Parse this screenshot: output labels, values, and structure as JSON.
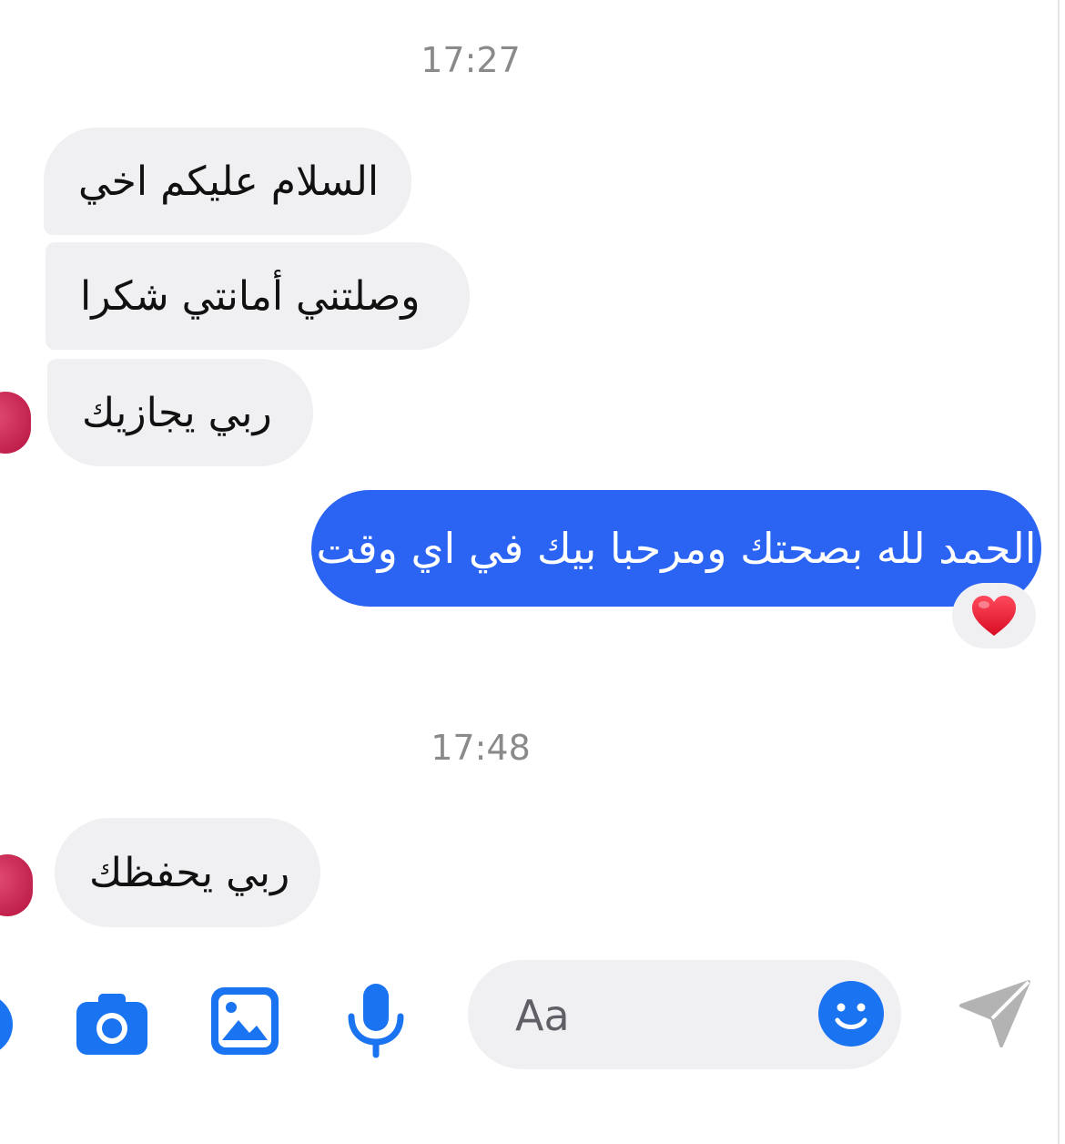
{
  "conversation": {
    "timestamps": [
      "17:27",
      "17:48"
    ],
    "messages": [
      {
        "direction": "incoming",
        "text": "السلام عليكم اخي"
      },
      {
        "direction": "incoming",
        "text": "وصلتني أمانتي شكرا"
      },
      {
        "direction": "incoming",
        "text": "ربي يجازيك"
      },
      {
        "direction": "outgoing",
        "text": "الحمد لله بصحتك ومرحبا بيك في اي وقت",
        "reaction": "heart"
      },
      {
        "direction": "incoming",
        "text": "ربي يحفظك"
      }
    ]
  },
  "composer": {
    "placeholder": "Aa",
    "icons": [
      "more-icon",
      "camera-icon",
      "gallery-icon",
      "microphone-icon",
      "emoji-icon",
      "send-icon"
    ]
  },
  "colors": {
    "accent": "#1a73f0",
    "outgoing_bubble": "#2b64f2",
    "incoming_bubble": "#f0f0f3",
    "send_disabled": "#b3b3b3",
    "reaction_heart": "#e8112d"
  }
}
